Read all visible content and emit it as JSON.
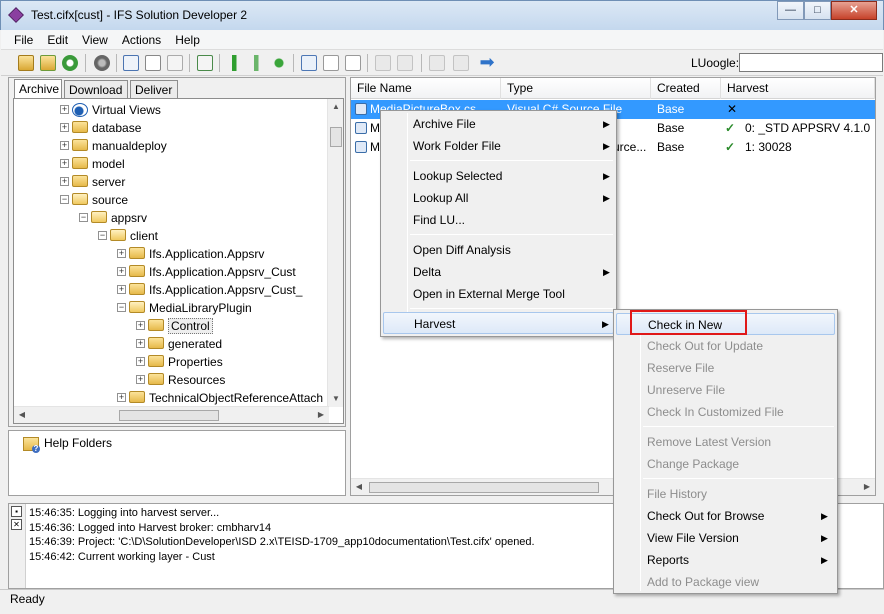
{
  "window": {
    "title": "Test.cifx[cust] - IFS Solution Developer 2",
    "minimize_icon": "minimize-icon",
    "maximize_icon": "maximize-icon",
    "close_icon": "close-icon",
    "minimize_glyph": "—",
    "maximize_glyph": "□",
    "close_glyph": "✕"
  },
  "menubar": {
    "file": "File",
    "edit": "Edit",
    "view": "View",
    "actions": "Actions",
    "help": "Help"
  },
  "toolbar": {
    "search_label": "LUoogle:",
    "search_value": "",
    "nav_forward_icon": "arrow-right-icon"
  },
  "left_tabs": {
    "archive": "Archive",
    "download": "Download",
    "deliver": "Deliver"
  },
  "tree": {
    "virtual_views": "Virtual Views",
    "database": "database",
    "manualdeploy": "manualdeploy",
    "model": "model",
    "server": "server",
    "source": "source",
    "appsrv": "appsrv",
    "client": "client",
    "ifs_appsrv": "Ifs.Application.Appsrv",
    "ifs_appsrv_cust": "Ifs.Application.Appsrv_Cust",
    "ifs_appsrv_cust2": "Ifs.Application.Appsrv_Cust_",
    "media_plugin": "MediaLibraryPlugin",
    "control": "Control",
    "generated": "generated",
    "properties": "Properties",
    "resources": "Resources",
    "tech_attach": "TechnicalObjectReferenceAttach"
  },
  "help_pane": {
    "help_folders": "Help Folders"
  },
  "file_list": {
    "columns": {
      "file_name": "File Name",
      "type": "Type",
      "created": "Created",
      "harvest": "Harvest"
    },
    "rows": [
      {
        "name": "MediaPictureBox.cs",
        "type": "Visual C# Source File",
        "created": "Base",
        "status": "✕",
        "harvest": ""
      },
      {
        "name": "M",
        "type": "",
        "created": "Base",
        "status": "✓",
        "harvest": "0: _STD APPSRV 4.1.0"
      },
      {
        "name": "M",
        "type": "urce...",
        "created": "Base",
        "status": "✓",
        "harvest": "1: 30028"
      }
    ]
  },
  "context_menu": {
    "archive_file": "Archive File",
    "work_folder_file": "Work Folder File",
    "lookup_selected": "Lookup Selected",
    "lookup_all": "Lookup All",
    "find_lu": "Find LU...",
    "open_diff": "Open Diff Analysis",
    "delta": "Delta",
    "open_merge": "Open in External Merge Tool",
    "harvest": "Harvest",
    "submenu_arrow": "▶"
  },
  "harvest_menu": {
    "check_in_new": "Check in New",
    "check_out_update": "Check Out for Update",
    "reserve_file": "Reserve File",
    "unreserve_file": "Unreserve File",
    "check_in_customized": "Check In Customized File",
    "remove_latest": "Remove Latest Version",
    "change_package": "Change Package",
    "file_history": "File History",
    "check_out_browse": "Check Out for Browse",
    "view_file_version": "View File Version",
    "reports": "Reports",
    "add_to_package": "Add to Package view"
  },
  "log": {
    "lines": [
      "15:46:35: Logging into harvest server...",
      "15:46:36: Logged into Harvest broker: cmbharv14",
      "15:46:39: Project: 'C:\\D\\SolutionDeveloper\\ISD 2.x\\TEISD-1709_app10documentation\\Test.cifx' opened.",
      "15:46:42: Current working layer - Cust"
    ],
    "close_glyph": "✕",
    "pin_glyph": "▪"
  },
  "status": {
    "text": "Ready"
  },
  "colors": {
    "selection": "#3399ff",
    "highlight_box": "#e01818",
    "check_ok": "#2a8a2a"
  }
}
